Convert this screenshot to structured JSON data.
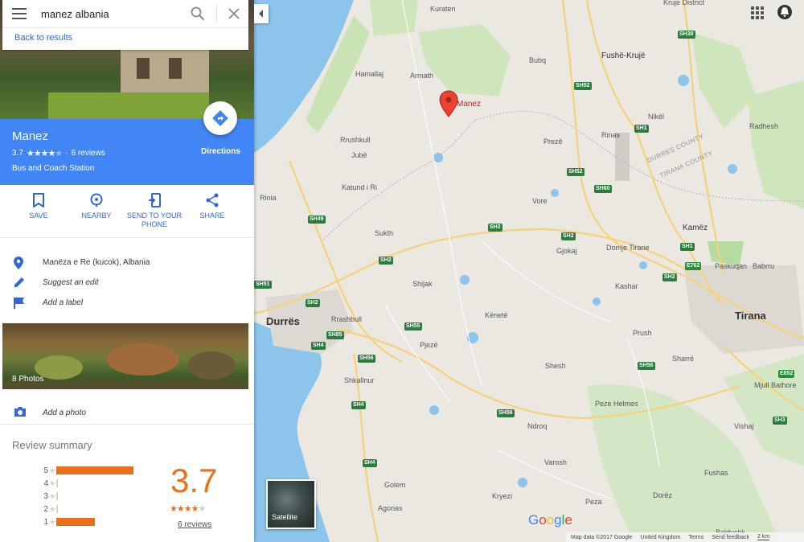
{
  "search": {
    "value": "manez albania",
    "back_label": "Back to results"
  },
  "place": {
    "name": "Manez",
    "rating": "3.7",
    "reviews_text": "6 reviews",
    "category": "Bus and Coach Station",
    "directions_label": "Directions"
  },
  "actions": [
    {
      "label": "SAVE"
    },
    {
      "label": "NEARBY"
    },
    {
      "label": "SEND TO YOUR PHONE"
    },
    {
      "label": "SHARE"
    }
  ],
  "info": {
    "address": "Manëza e Re (kucok), Albania",
    "suggest_edit": "Suggest an edit",
    "add_label": "Add a label"
  },
  "photos_label": "8 Photos",
  "add_photo_label": "Add a photo",
  "review_summary": {
    "title": "Review summary",
    "score": "3.7",
    "score_value": 3.7,
    "reviews_link": "6 reviews",
    "distribution": [
      {
        "stars": "5",
        "fraction": 1.0
      },
      {
        "stars": "4",
        "fraction": 0.0
      },
      {
        "stars": "3",
        "fraction": 0.0
      },
      {
        "stars": "2",
        "fraction": 0.0
      },
      {
        "stars": "1",
        "fraction": 0.5
      }
    ]
  },
  "map": {
    "pin_label": "Manez",
    "satellite_label": "Satellite",
    "places": [
      {
        "name": "Kuraten",
        "kind": "village"
      },
      {
        "name": "Hamallaj",
        "kind": "village"
      },
      {
        "name": "Armath",
        "kind": "village"
      },
      {
        "name": "Bubq",
        "kind": "village"
      },
      {
        "name": "Fushë-Krujë",
        "kind": "town"
      },
      {
        "name": "Kruje District",
        "kind": "village"
      },
      {
        "name": "Nikël",
        "kind": "village"
      },
      {
        "name": "Radhesh",
        "kind": "village"
      },
      {
        "name": "Rinas",
        "kind": "village"
      },
      {
        "name": "Prezë",
        "kind": "village"
      },
      {
        "name": "Rrushkull",
        "kind": "village"
      },
      {
        "name": "Jubë",
        "kind": "village"
      },
      {
        "name": "Katund i Ri",
        "kind": "village"
      },
      {
        "name": "Rinia",
        "kind": "village"
      },
      {
        "name": "Vore",
        "kind": "village"
      },
      {
        "name": "Sukth",
        "kind": "village"
      },
      {
        "name": "Gjokaj",
        "kind": "village"
      },
      {
        "name": "Domje Tirane",
        "kind": "village"
      },
      {
        "name": "Kamëz",
        "kind": "town"
      },
      {
        "name": "Paskuqan",
        "kind": "village"
      },
      {
        "name": "Babrru",
        "kind": "village"
      },
      {
        "name": "Kashar",
        "kind": "village"
      },
      {
        "name": "Shijak",
        "kind": "village"
      },
      {
        "name": "Durrës",
        "kind": "city"
      },
      {
        "name": "Rrashbull",
        "kind": "village"
      },
      {
        "name": "Tirana",
        "kind": "city"
      },
      {
        "name": "Kënetë",
        "kind": "village"
      },
      {
        "name": "Pjezë",
        "kind": "village"
      },
      {
        "name": "Prush",
        "kind": "village"
      },
      {
        "name": "Sharrë",
        "kind": "village"
      },
      {
        "name": "Mjull Bathore",
        "kind": "village"
      },
      {
        "name": "Shesh",
        "kind": "village"
      },
      {
        "name": "Shkallnur",
        "kind": "village"
      },
      {
        "name": "Peze Helmes",
        "kind": "village"
      },
      {
        "name": "Ndroq",
        "kind": "village"
      },
      {
        "name": "Vishaj",
        "kind": "village"
      },
      {
        "name": "Varosh",
        "kind": "village"
      },
      {
        "name": "Fushas",
        "kind": "village"
      },
      {
        "name": "Golem",
        "kind": "village"
      },
      {
        "name": "Kryezi",
        "kind": "village"
      },
      {
        "name": "Peza",
        "kind": "village"
      },
      {
        "name": "Dorëz",
        "kind": "village"
      },
      {
        "name": "Agonas",
        "kind": "village"
      },
      {
        "name": "Baldushk",
        "kind": "village"
      }
    ],
    "roads": [
      "SH38",
      "SH52",
      "SH1",
      "SH52",
      "SH60",
      "SH2",
      "SH49",
      "SH2",
      "SH2",
      "SH1",
      "E762",
      "SH2",
      "SH51",
      "SH2",
      "SH85",
      "SH4",
      "SH55",
      "SH56",
      "SH56",
      "E852",
      "SH4",
      "SH56",
      "SH3",
      "SH4"
    ],
    "counties": [
      "DURRES COUNTY",
      "TIRANA COUNTY"
    ]
  },
  "footer": {
    "map_data": "Map data ©2017 Google",
    "region": "United Kingdom",
    "terms": "Terms",
    "feedback": "Send feedback",
    "scale": "2 km"
  }
}
